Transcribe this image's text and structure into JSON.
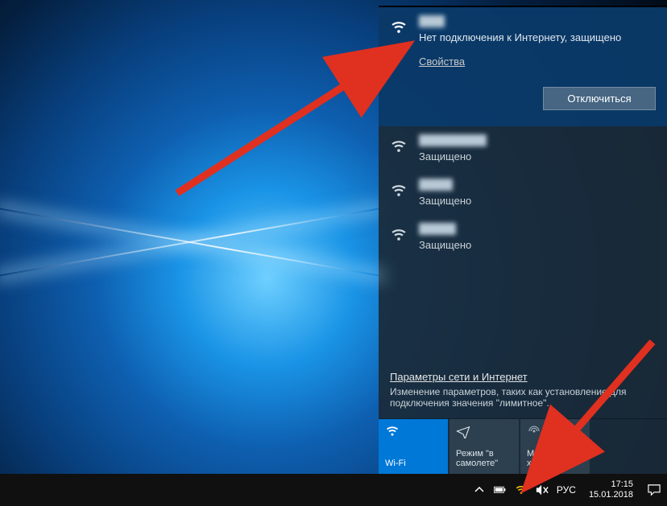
{
  "connected_network": {
    "ssid": "████",
    "status": "Нет подключения к Интернету, защищено",
    "properties_label": "Свойства",
    "disconnect_label": "Отключиться"
  },
  "other_networks": [
    {
      "ssid": "██████████",
      "status": "Защищено"
    },
    {
      "ssid": "█████",
      "status": "Защищено"
    },
    {
      "ssid": "█████",
      "status": "Защищено"
    }
  ],
  "settings": {
    "link_label": "Параметры сети и Интернет",
    "description": "Изменение параметров, таких как установление для подключения значения \"лимитное\"."
  },
  "tiles": {
    "wifi": "Wi-Fi",
    "airplane": "Режим \"в самолете\"",
    "hotspot": "Мобильный хот-спот"
  },
  "taskbar": {
    "lang": "РУС",
    "time": "17:15",
    "date": "15.01.2018"
  },
  "ssid_widths": {
    "connected": "32px",
    "n0": "84px",
    "n1": "42px",
    "n2": "46px"
  }
}
